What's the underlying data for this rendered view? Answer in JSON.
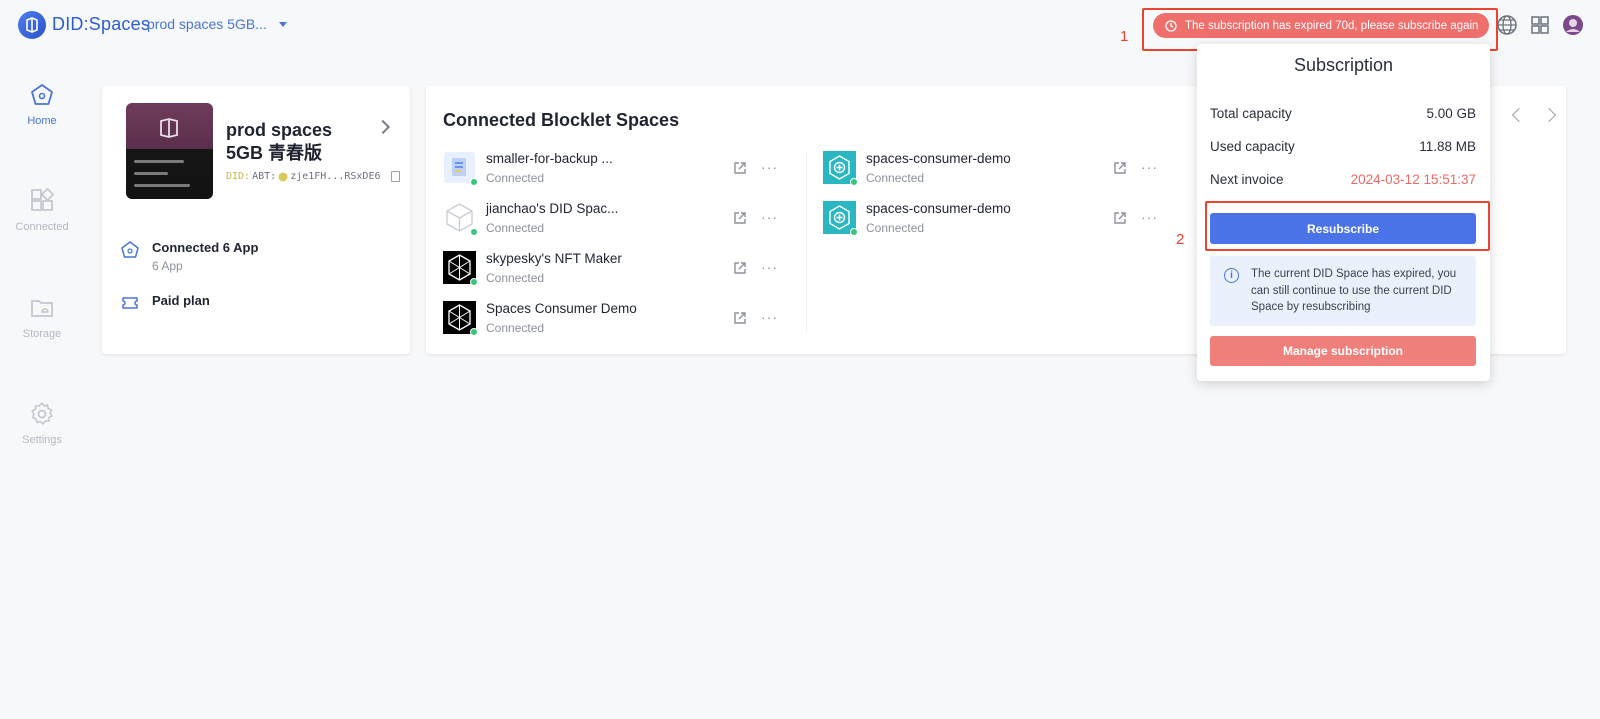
{
  "header": {
    "logo_text": "DID:Spaces",
    "space_selector": "prod spaces 5GB...",
    "expired_banner": "The subscription has expired 70d, please subscribe again",
    "callout_1": "1",
    "callout_2": "2"
  },
  "sidebar": {
    "items": [
      {
        "label": "Home",
        "icon": "home-icon",
        "active": true
      },
      {
        "label": "Connected",
        "icon": "apps-icon",
        "active": false
      },
      {
        "label": "Storage",
        "icon": "folder-icon",
        "active": false
      },
      {
        "label": "Settings",
        "icon": "gear-icon",
        "active": false
      }
    ]
  },
  "space_card": {
    "name": "prod spaces 5GB 青春版",
    "did_prefix": "DID:",
    "did_chain": "ABT:",
    "did_value": "zje1FH...RSxDE6",
    "connected_title": "Connected 6 App",
    "connected_sub": "6 App",
    "plan": "Paid plan"
  },
  "apps": {
    "title": "Connected Blocklet Spaces",
    "items": [
      {
        "name": "smaller-for-backup ...",
        "status": "Connected",
        "icon": "doc-app-icon"
      },
      {
        "name": "jianchao's DID Spac...",
        "status": "Connected",
        "icon": "box-app-icon"
      },
      {
        "name": "skypesky's NFT Maker",
        "status": "Connected",
        "icon": "hex-app-icon"
      },
      {
        "name": "Spaces Consumer Demo",
        "status": "Connected",
        "icon": "hex-app-icon"
      },
      {
        "name": "spaces-consumer-demo",
        "status": "Connected",
        "icon": "medical-app-icon"
      },
      {
        "name": "spaces-consumer-demo",
        "status": "Connected",
        "icon": "medical-app-icon"
      }
    ]
  },
  "popover": {
    "title": "Subscription",
    "total_label": "Total capacity",
    "total_value": "5.00 GB",
    "used_label": "Used capacity",
    "used_value": "11.88 MB",
    "invoice_label": "Next invoice",
    "invoice_value": "2024-03-12 15:51:37",
    "resubscribe_label": "Resubscribe",
    "notice": "The current DID Space has expired, you can still continue to use the current DID Space by resubscribing",
    "manage_label": "Manage subscription"
  },
  "colors": {
    "accent": "#4a73e8",
    "danger": "#ee6f6c",
    "success": "#34c77b"
  }
}
